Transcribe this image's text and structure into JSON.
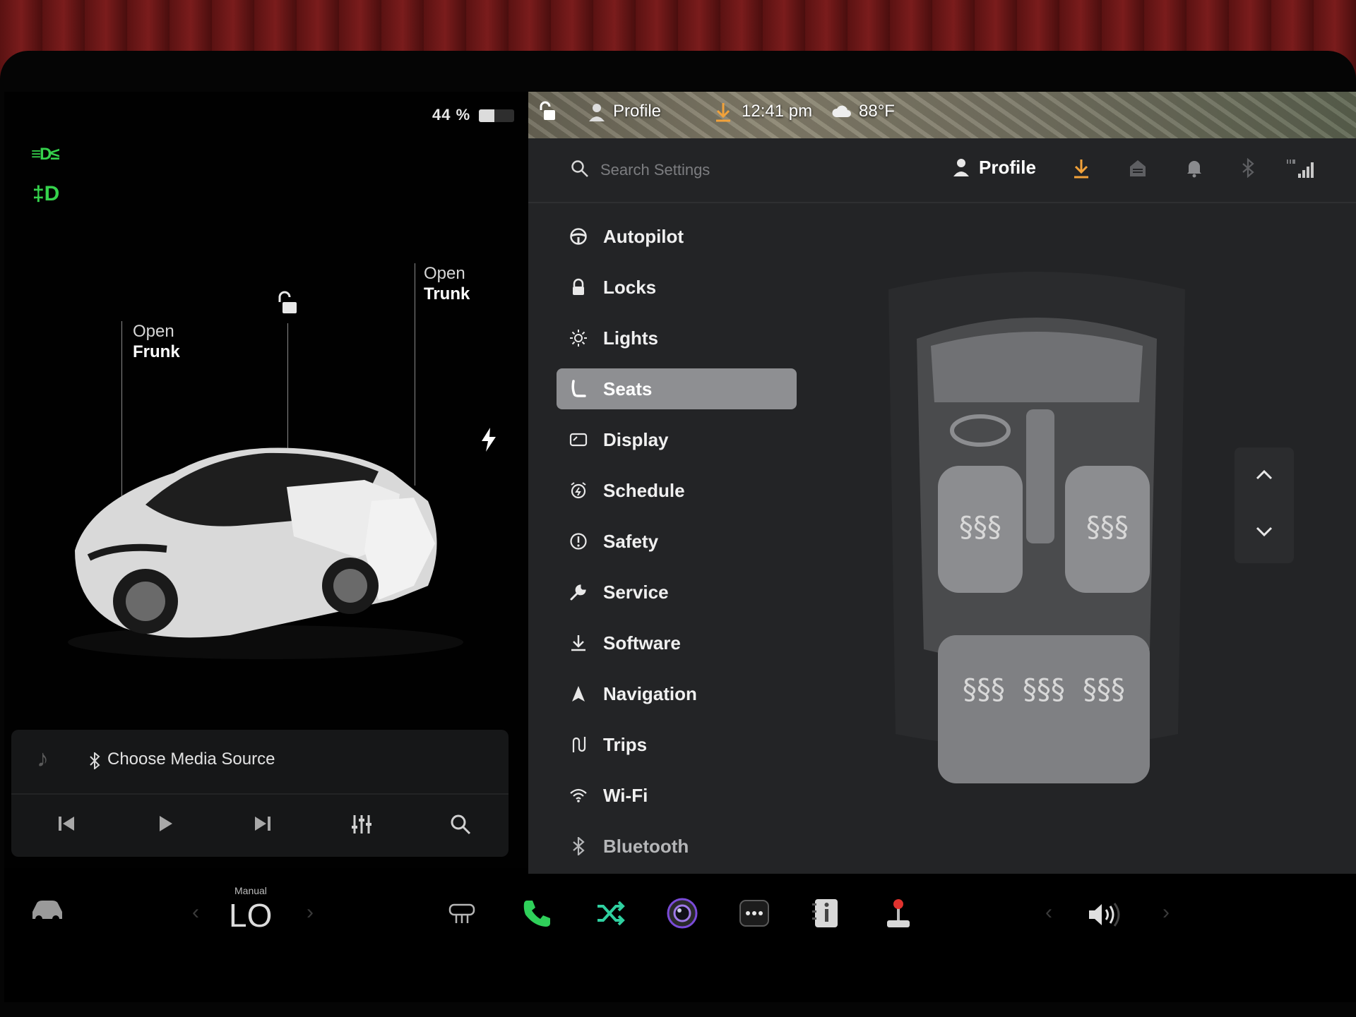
{
  "status": {
    "battery_text": "44 %",
    "battery_level": 0.44
  },
  "car": {
    "frunk_line1": "Open",
    "frunk_line2": "Frunk",
    "trunk_line1": "Open",
    "trunk_line2": "Trunk"
  },
  "media": {
    "source_label": "Choose Media Source"
  },
  "map_bar": {
    "profile": "Profile",
    "time": "12:41 pm",
    "temp": "88°F"
  },
  "header": {
    "search_placeholder": "Search Settings",
    "profile": "Profile"
  },
  "menu": {
    "items": [
      {
        "label": "Autopilot",
        "icon": "steering-wheel-icon"
      },
      {
        "label": "Locks",
        "icon": "lock-icon"
      },
      {
        "label": "Lights",
        "icon": "sun-icon"
      },
      {
        "label": "Seats",
        "icon": "seat-icon",
        "active": true
      },
      {
        "label": "Display",
        "icon": "display-icon"
      },
      {
        "label": "Schedule",
        "icon": "alarm-clock-icon"
      },
      {
        "label": "Safety",
        "icon": "exclamation-circle-icon"
      },
      {
        "label": "Service",
        "icon": "wrench-icon"
      },
      {
        "label": "Software",
        "icon": "download-icon"
      },
      {
        "label": "Navigation",
        "icon": "navigation-arrow-icon"
      },
      {
        "label": "Trips",
        "icon": "trips-icon"
      },
      {
        "label": "Wi-Fi",
        "icon": "wifi-icon"
      },
      {
        "label": "Bluetooth",
        "icon": "bluetooth-icon"
      }
    ]
  },
  "climate": {
    "mode": "Manual",
    "temp": "LO"
  },
  "colors": {
    "accent_orange": "#f2a23a",
    "tell_green": "#35d24c",
    "phone_green": "#2fd05a",
    "active_item": "#8e8f92"
  }
}
